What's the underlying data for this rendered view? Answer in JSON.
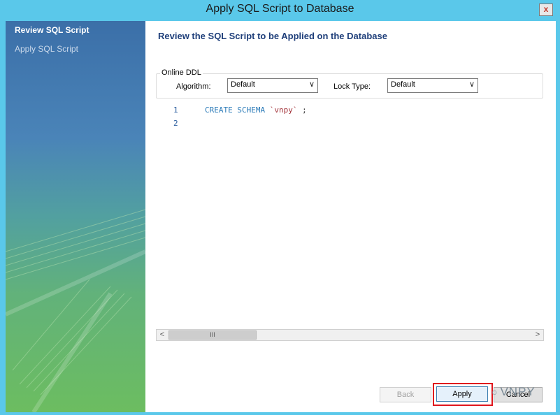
{
  "window": {
    "title": "Apply SQL Script to Database",
    "close_glyph": "x"
  },
  "sidebar": {
    "items": [
      {
        "label": "Review SQL Script",
        "active": true
      },
      {
        "label": "Apply SQL Script",
        "active": false
      }
    ]
  },
  "main": {
    "heading": "Review the SQL Script to be Applied on the Database",
    "online_ddl": {
      "group_label": "Online DDL",
      "algorithm_label": "Algorithm:",
      "algorithm_value": "Default",
      "lock_type_label": "Lock Type:",
      "lock_type_value": "Default"
    },
    "editor": {
      "lines": [
        {
          "number": "1",
          "keyword": "CREATE SCHEMA",
          "identifier": "`vnpy`",
          "terminator": ";"
        },
        {
          "number": "2",
          "keyword": "",
          "identifier": "",
          "terminator": ""
        }
      ]
    },
    "scrollbar": {
      "left_glyph": "<",
      "right_glyph": ">",
      "thumb_glyph": "III"
    }
  },
  "buttons": {
    "back": "Back",
    "apply": "Apply",
    "cancel": "Cancel"
  },
  "watermark": {
    "text": "VNPY"
  },
  "colors": {
    "title_bar": "#5ac8ea",
    "heading": "#1f3f7a",
    "highlight": "#e0161d",
    "sql_keyword": "#2a7ab8",
    "sql_identifier": "#a3333a"
  }
}
